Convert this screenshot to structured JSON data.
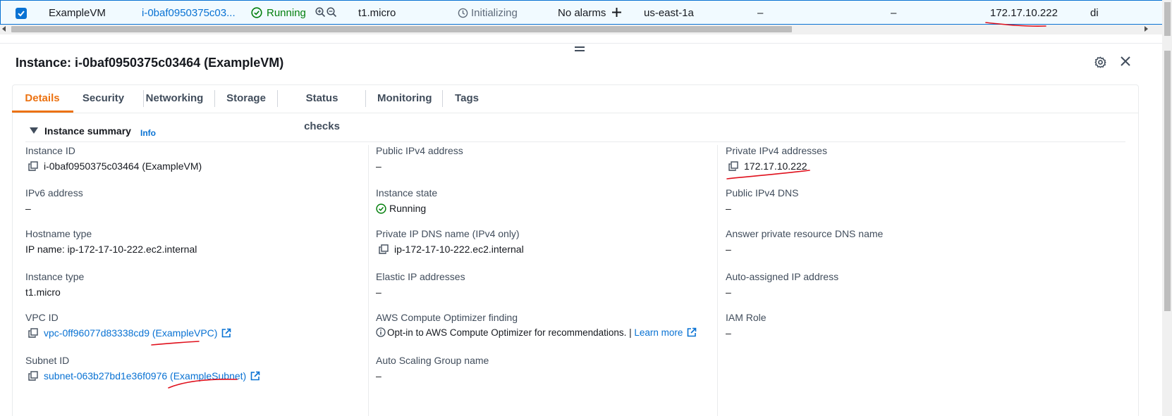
{
  "table_row": {
    "name": "ExampleVM",
    "instance_id": "i-0baf0950375c03...",
    "state": "Running",
    "type": "t1.micro",
    "status_check": "Initializing",
    "alarm": "No alarms",
    "az": "us-east-1a",
    "public_dns": "–",
    "public_ip": "–",
    "private_ip": "172.17.10.222",
    "next_col": "di"
  },
  "panel": {
    "title": "Instance: i-0baf0950375c03464 (ExampleVM)"
  },
  "tabs": [
    {
      "label": "Details"
    },
    {
      "label": "Security"
    },
    {
      "label": "Networking"
    },
    {
      "label": "Storage"
    },
    {
      "label": "Status checks"
    },
    {
      "label": "Monitoring"
    },
    {
      "label": "Tags"
    }
  ],
  "summary": {
    "title": "Instance summary",
    "info": "Info"
  },
  "fields": {
    "instance_id": {
      "label": "Instance ID",
      "value": "i-0baf0950375c03464 (ExampleVM)"
    },
    "ipv6": {
      "label": "IPv6 address",
      "value": "–"
    },
    "hostname_type": {
      "label": "Hostname type",
      "value": "IP name: ip-172-17-10-222.ec2.internal"
    },
    "instance_type": {
      "label": "Instance type",
      "value": "t1.micro"
    },
    "vpc_id": {
      "label": "VPC ID",
      "value": "vpc-0ff96077d83338cd9 (ExampleVPC)"
    },
    "subnet_id": {
      "label": "Subnet ID",
      "value": "subnet-063b27bd1e36f0976 (ExampleSubnet)"
    },
    "public_ipv4": {
      "label": "Public IPv4 address",
      "value": "–"
    },
    "instance_state": {
      "label": "Instance state",
      "value": "Running"
    },
    "private_dns": {
      "label": "Private IP DNS name (IPv4 only)",
      "value": "ip-172-17-10-222.ec2.internal"
    },
    "elastic_ip": {
      "label": "Elastic IP addresses",
      "value": "–"
    },
    "optimizer": {
      "label": "AWS Compute Optimizer finding",
      "value": "Opt-in to AWS Compute Optimizer for recommendations. | ",
      "link": "Learn more"
    },
    "asg": {
      "label": "Auto Scaling Group name",
      "value": "–"
    },
    "private_ipv4": {
      "label": "Private IPv4 addresses",
      "value": "172.17.10.222"
    },
    "public_dns": {
      "label": "Public IPv4 DNS",
      "value": "–"
    },
    "answer_dns": {
      "label": "Answer private resource DNS name",
      "value": "–"
    },
    "auto_ip": {
      "label": "Auto-assigned IP address",
      "value": "–"
    },
    "iam_role": {
      "label": "IAM Role",
      "value": "–"
    }
  },
  "colors": {
    "accent": "#0972d3",
    "active_tab": "#ec7211",
    "running": "#037f0c",
    "annotation": "#e0101c"
  }
}
